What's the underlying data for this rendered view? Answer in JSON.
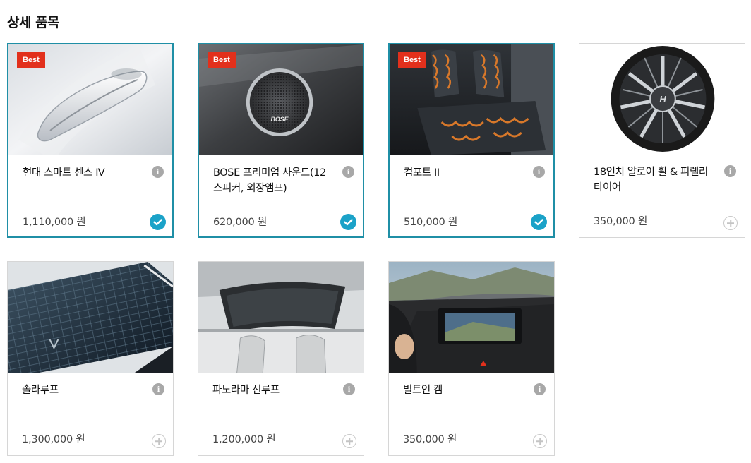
{
  "section": {
    "title": "상세 품목"
  },
  "items": [
    {
      "name": "현대 스마트 센스 Ⅳ",
      "price": "1,110,000 원",
      "badge": "Best",
      "selected": true,
      "image": "door-handle"
    },
    {
      "name": "BOSE 프리미엄 사운드(12스피커, 외장앰프)",
      "price": "620,000 원",
      "badge": "Best",
      "selected": true,
      "image": "bose-speaker"
    },
    {
      "name": "컴포트 II",
      "price": "510,000 원",
      "badge": "Best",
      "selected": true,
      "image": "heated-seats"
    },
    {
      "name": "18인치 알로이 휠 & 피렐리 타이어",
      "price": "350,000 원",
      "badge": "",
      "selected": false,
      "image": "alloy-wheel"
    },
    {
      "name": "솔라루프",
      "price": "1,300,000 원",
      "badge": "",
      "selected": false,
      "image": "solar-roof"
    },
    {
      "name": "파노라마 선루프",
      "price": "1,200,000 원",
      "badge": "",
      "selected": false,
      "image": "panorama-sunroof"
    },
    {
      "name": "빌트인 캠",
      "price": "350,000 원",
      "badge": "",
      "selected": false,
      "image": "builtin-cam"
    }
  ],
  "icons": {
    "info": "info-icon",
    "check": "check-circle-icon",
    "add": "plus-circle-icon"
  },
  "colors": {
    "selected_border": "#1f8fa6",
    "check": "#1ba2c8",
    "badge": "#e2301c"
  }
}
